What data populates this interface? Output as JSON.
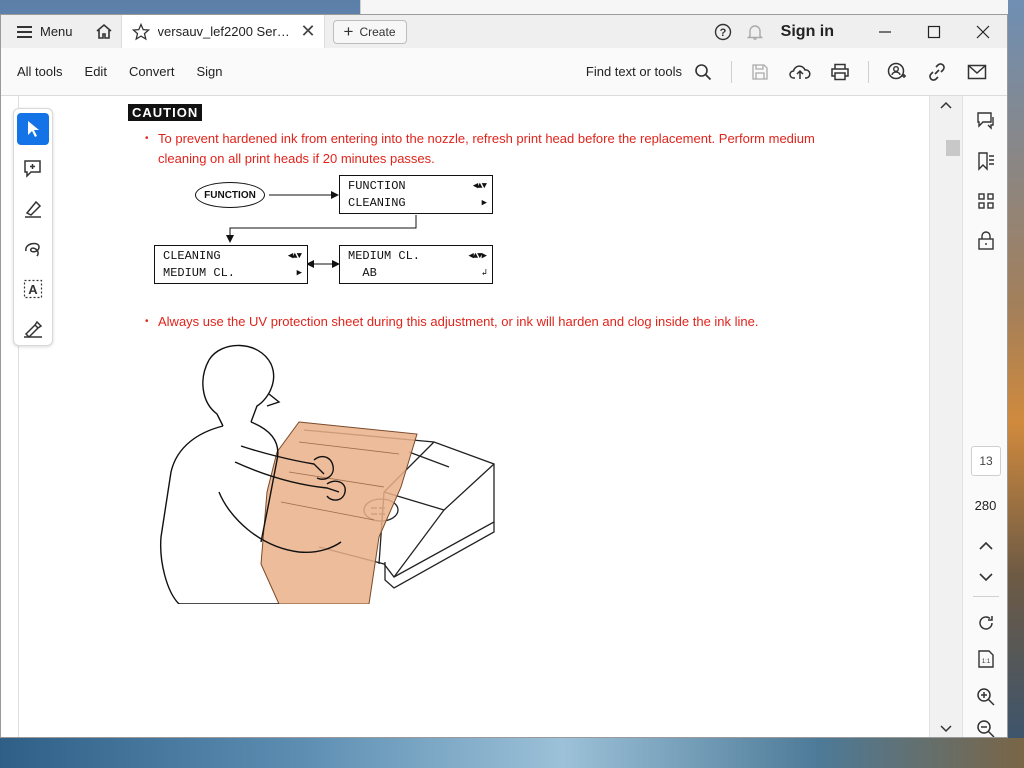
{
  "titlebar": {
    "menu_label": "Menu",
    "tab_title": "versauv_lef2200 Service...",
    "create_label": "Create",
    "signin_label": "Sign in"
  },
  "toolbar": {
    "items": [
      "All tools",
      "Edit",
      "Convert",
      "Sign"
    ],
    "find_label": "Find text or tools"
  },
  "document": {
    "caution_label": "CAUTION",
    "bullet1": "To prevent hardened ink from entering into the nozzle, refresh print head before the replacement. Perform medium cleaning on all print heads if 20 minutes passes.",
    "bullet2": "Always use the UV protection sheet during this adjustment, or ink will harden and clog inside the ink line.",
    "diagram": {
      "function_key": "FUNCTION",
      "lcd1_line1": "FUNCTION",
      "lcd1_line2": "CLEANING",
      "lcd2_line1": "CLEANING",
      "lcd2_line2": "MEDIUM CL.",
      "lcd3_line1": "MEDIUM CL.",
      "lcd3_line2": "  AB"
    }
  },
  "navigation": {
    "current_page": "13",
    "total_pages": "280"
  },
  "colors": {
    "caution_text": "#e0241c",
    "active_tool": "#1473e6",
    "protection_sheet": "#e9b08a"
  }
}
